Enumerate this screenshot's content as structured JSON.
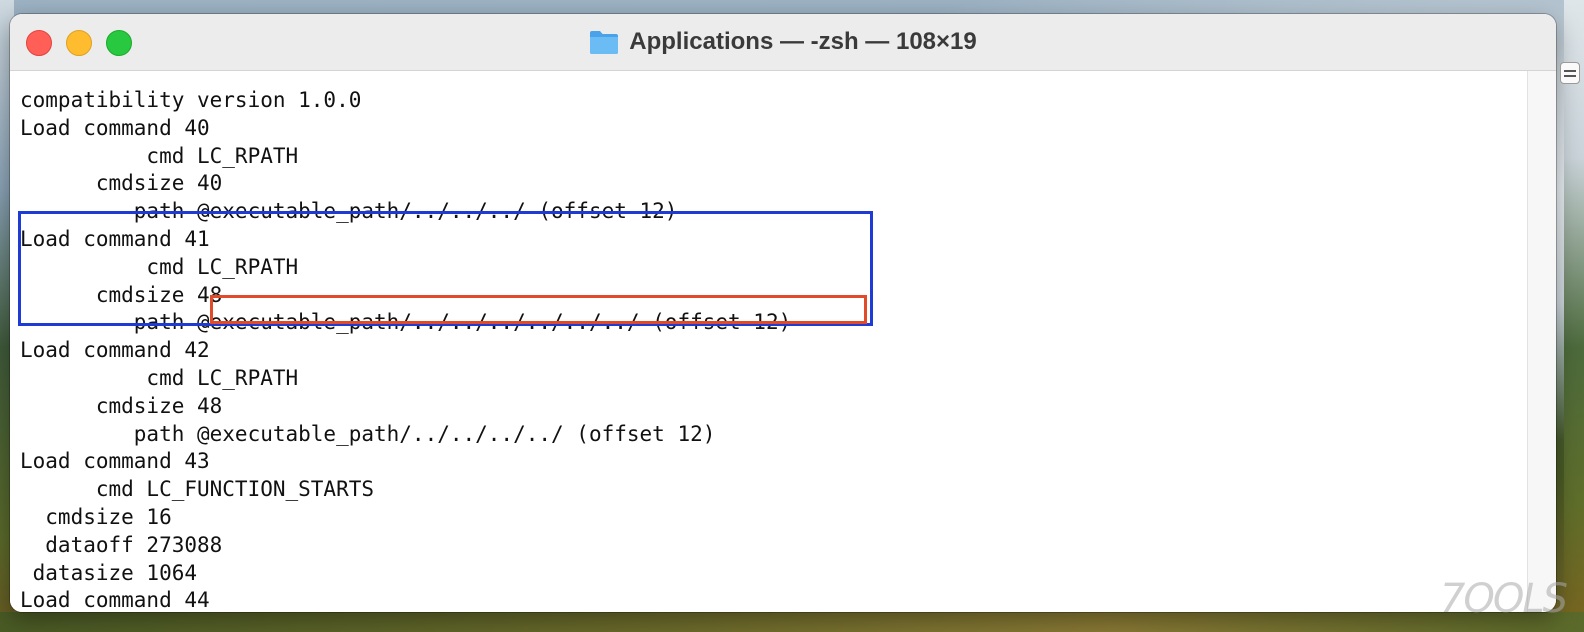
{
  "window": {
    "title": "Applications — -zsh — 108×19",
    "folder_icon": "folder-icon"
  },
  "terminal": {
    "lines": [
      "compatibility version 1.0.0",
      "Load command 40",
      "          cmd LC_RPATH",
      "      cmdsize 40",
      "         path @executable_path/../../../ (offset 12)",
      "Load command 41",
      "          cmd LC_RPATH",
      "      cmdsize 48",
      "         path @executable_path/../../../../../../ (offset 12)",
      "Load command 42",
      "          cmd LC_RPATH",
      "      cmdsize 48",
      "         path @executable_path/../../../../ (offset 12)",
      "Load command 43",
      "      cmd LC_FUNCTION_STARTS",
      "  cmdsize 16",
      "  dataoff 273088",
      " datasize 1064",
      "Load command 44"
    ]
  },
  "annotations": {
    "blue_box_color": "#1f3bd6",
    "red_box_color": "#e24b2a"
  },
  "watermark": {
    "text": "7OOLS"
  }
}
